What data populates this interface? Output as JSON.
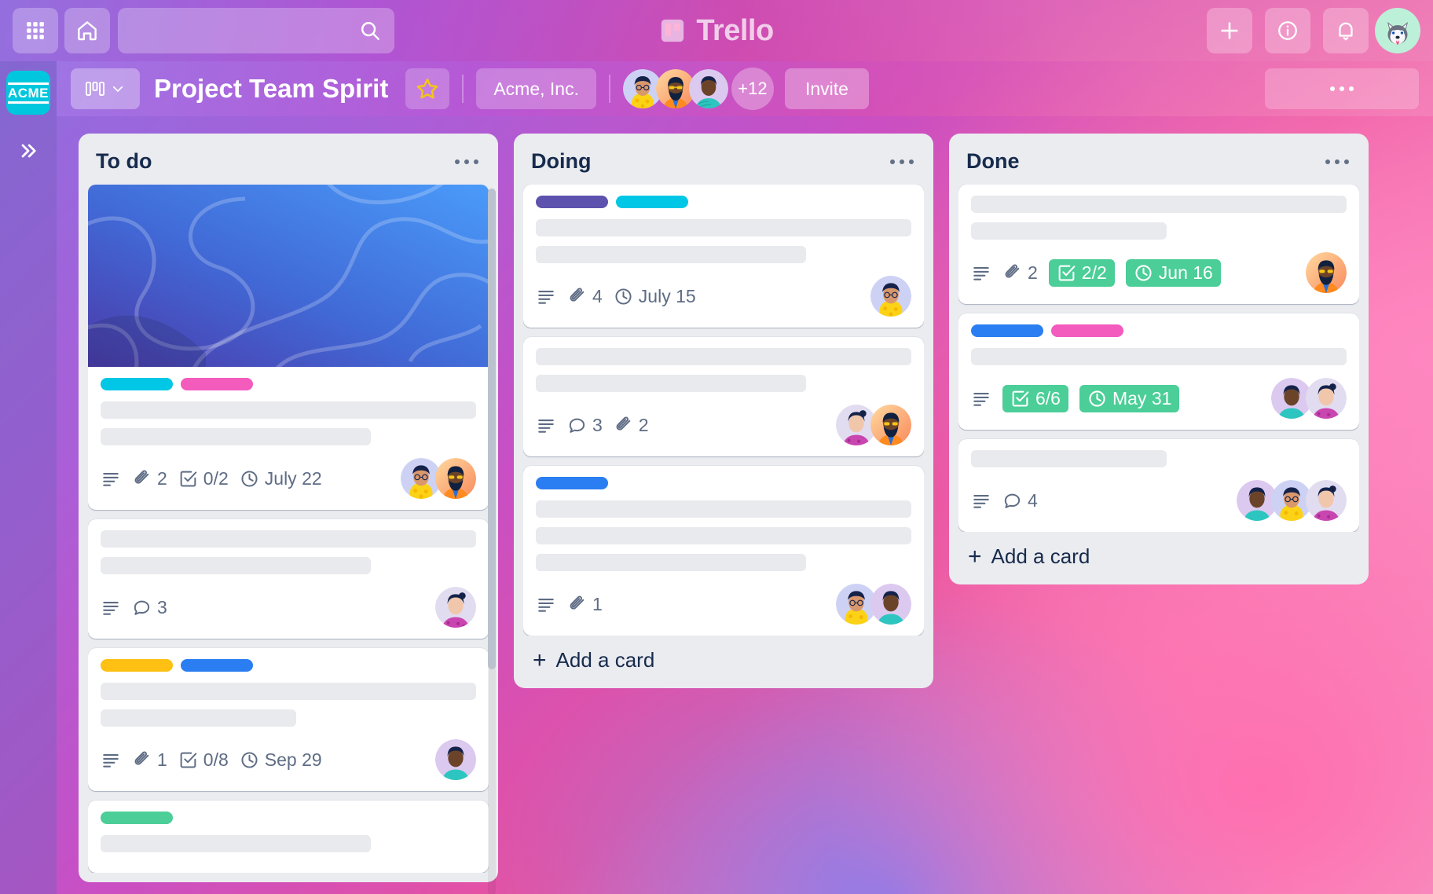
{
  "topbar": {
    "apps_icon": "grid-apps-icon",
    "home_icon": "home-icon",
    "search_placeholder": "",
    "search_value": "",
    "search_icon": "search-icon",
    "brand": "Trello",
    "brand_icon": "trello-board-icon",
    "create_icon": "plus-icon",
    "info_icon": "info-circle-icon",
    "notifications_icon": "bell-icon",
    "avatar": "husky-dog-avatar"
  },
  "rail": {
    "logo_text": "ACME",
    "expand_icon": "chevron-double-right-icon"
  },
  "board_header": {
    "view_switch_icon": "board-view-icon",
    "view_switch_chevron": "chevron-down-icon",
    "title": "Project Team Spirit",
    "star_icon": "star-icon",
    "workspace": "Acme, Inc.",
    "members_overflow": "+12",
    "invite_label": "Invite",
    "more_icon": "ellipsis-icon"
  },
  "colors": {
    "label_cyan": "#00c7e5",
    "label_pink": "#f35bbd",
    "label_yellow": "#fdc013",
    "label_blue": "#2a7ef1",
    "label_purple": "#5d52ae",
    "label_green": "#4bce97",
    "badge_green": "#4bce97",
    "list_bg": "#ebecf0",
    "text_dark": "#172b4d",
    "text_muted": "#5e6c84",
    "acme_cyan": "#00c7dd"
  },
  "lists": [
    {
      "title": "To do",
      "more_icon": "ellipsis-icon",
      "has_scrollbar": true,
      "add_card_label": "",
      "cards": [
        {
          "cover": "blue-abstract-gradient-cover",
          "labels": [
            "#00c7e5",
            "#f35bbd"
          ],
          "title_lines": [
            "long",
            "mid"
          ],
          "badges": [
            {
              "icon": "description-icon",
              "text": ""
            },
            {
              "icon": "attachment-icon",
              "text": "2"
            },
            {
              "icon": "checklist-icon",
              "text": "0/2"
            },
            {
              "icon": "clock-icon",
              "text": "July 22"
            }
          ],
          "avatars": [
            "member-glasses-yellow",
            "member-beard-orange"
          ]
        },
        {
          "cover": null,
          "labels": [],
          "title_lines": [
            "long",
            "mid"
          ],
          "badges": [
            {
              "icon": "description-icon",
              "text": ""
            },
            {
              "icon": "comment-icon",
              "text": "3"
            }
          ],
          "avatars": [
            "member-bun-purple"
          ]
        },
        {
          "cover": null,
          "labels": [
            "#fdc013",
            "#2a7ef1"
          ],
          "title_lines": [
            "long",
            "short"
          ],
          "badges": [
            {
              "icon": "description-icon",
              "text": ""
            },
            {
              "icon": "attachment-icon",
              "text": "1"
            },
            {
              "icon": "checklist-icon",
              "text": "0/8"
            },
            {
              "icon": "clock-icon",
              "text": "Sep 29"
            }
          ],
          "avatars": [
            "member-teal-top"
          ]
        },
        {
          "cover": null,
          "labels": [
            "#4bce97"
          ],
          "title_lines": [
            "mid"
          ],
          "badges": [],
          "avatars": []
        }
      ]
    },
    {
      "title": "Doing",
      "more_icon": "ellipsis-icon",
      "has_scrollbar": false,
      "add_card_label": "Add a card",
      "cards": [
        {
          "cover": null,
          "labels": [
            "#5d52ae",
            "#00c7e5"
          ],
          "title_lines": [
            "long",
            "mid"
          ],
          "badges": [
            {
              "icon": "description-icon",
              "text": ""
            },
            {
              "icon": "attachment-icon",
              "text": "4"
            },
            {
              "icon": "clock-icon",
              "text": "July 15"
            }
          ],
          "avatars": [
            "member-glasses-yellow"
          ]
        },
        {
          "cover": null,
          "labels": [],
          "title_lines": [
            "long",
            "mid"
          ],
          "badges": [
            {
              "icon": "description-icon",
              "text": ""
            },
            {
              "icon": "comment-icon",
              "text": "3"
            },
            {
              "icon": "attachment-icon",
              "text": "2"
            }
          ],
          "avatars": [
            "member-bun-purple",
            "member-beard-orange"
          ]
        },
        {
          "cover": null,
          "labels": [
            "#2a7ef1"
          ],
          "title_lines": [
            "long",
            "long",
            "mid"
          ],
          "badges": [
            {
              "icon": "description-icon",
              "text": ""
            },
            {
              "icon": "attachment-icon",
              "text": "1"
            }
          ],
          "avatars": [
            "member-glasses-yellow",
            "member-teal-top"
          ]
        }
      ]
    },
    {
      "title": "Done",
      "more_icon": "ellipsis-icon",
      "has_scrollbar": false,
      "add_card_label": "Add a card",
      "cards": [
        {
          "cover": null,
          "labels": [],
          "title_lines": [
            "long",
            "short"
          ],
          "badges": [
            {
              "icon": "description-icon",
              "text": ""
            },
            {
              "icon": "attachment-icon",
              "text": "2"
            },
            {
              "icon": "checklist-icon",
              "text": "2/2",
              "green": true
            },
            {
              "icon": "clock-icon",
              "text": "Jun 16",
              "green": true
            }
          ],
          "avatars": [
            "member-beard-orange"
          ]
        },
        {
          "cover": null,
          "labels": [
            "#2a7ef1",
            "#f35bbd"
          ],
          "title_lines": [
            "long"
          ],
          "badges": [
            {
              "icon": "description-icon",
              "text": ""
            },
            {
              "icon": "checklist-icon",
              "text": "6/6",
              "green": true
            },
            {
              "icon": "clock-icon",
              "text": "May 31",
              "green": true
            }
          ],
          "avatars": [
            "member-teal-top",
            "member-bun-purple"
          ]
        },
        {
          "cover": null,
          "labels": [],
          "title_lines": [
            "short"
          ],
          "badges": [
            {
              "icon": "description-icon",
              "text": ""
            },
            {
              "icon": "comment-icon",
              "text": "4"
            }
          ],
          "avatars": [
            "member-teal-top",
            "member-glasses-yellow",
            "member-bun-purple"
          ]
        }
      ]
    }
  ]
}
